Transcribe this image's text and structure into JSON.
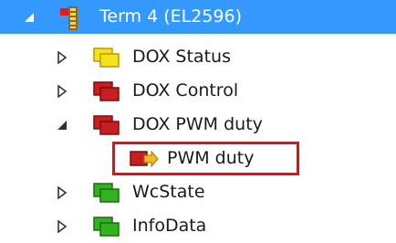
{
  "tree": {
    "items": [
      {
        "label": "Term 4 (EL2596)",
        "expander": "expanded",
        "icon": "terminal-icon",
        "selected": true
      },
      {
        "label": "DOX Status",
        "expander": "collapsed",
        "icon": "yellow-input-group-icon",
        "color": "#f7e11f"
      },
      {
        "label": "DOX Control",
        "expander": "collapsed",
        "icon": "red-output-group-icon",
        "color": "#c81e1e"
      },
      {
        "label": "DOX PWM duty",
        "expander": "expanded",
        "icon": "red-output-group-icon",
        "color": "#c81e1e"
      },
      {
        "label": "PWM duty",
        "expander": "none",
        "icon": "output-variable-icon",
        "color": "#c81e1e",
        "highlighted": true
      },
      {
        "label": "WcState",
        "expander": "collapsed",
        "icon": "green-group-icon",
        "color": "#31b21e"
      },
      {
        "label": "InfoData",
        "expander": "collapsed",
        "icon": "green-group-icon",
        "color": "#31b21e"
      }
    ]
  },
  "colors": {
    "selection": "#3399ff",
    "highlight_border": "#e0101c"
  }
}
